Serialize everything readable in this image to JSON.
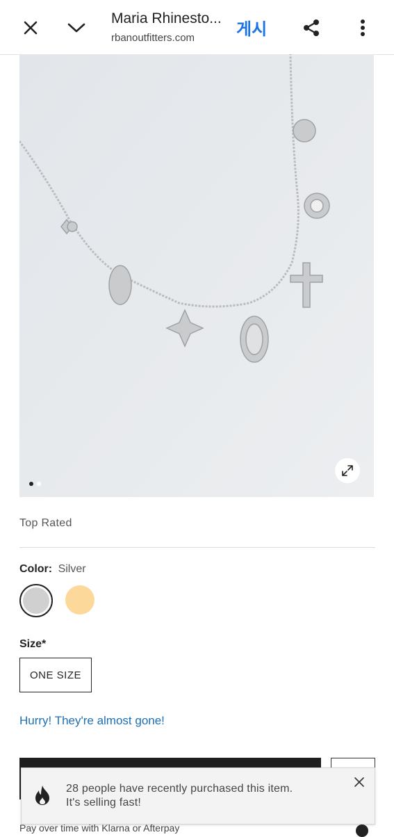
{
  "browser": {
    "title": "Maria Rhinesto...",
    "url": "rbanoutfitters.com",
    "post_label": "게시",
    "icons": [
      "close-icon",
      "chevron-down-icon",
      "share-icon",
      "more-vert-icon"
    ]
  },
  "gallery": {
    "image_desc": "necklace-product-image",
    "dots_count": 2,
    "active_dot": 0
  },
  "product": {
    "top_rated": "Top Rated",
    "color_label": "Color:",
    "color_value": "Silver",
    "swatches": [
      {
        "name": "Silver",
        "color": "#d0d0d0",
        "selected": true
      },
      {
        "name": "Gold",
        "color": "#fcd99a",
        "selected": false
      }
    ],
    "size_label": "Size*",
    "size_option": "ONE SIZE",
    "stock_message": "Hurry! They're almost gone!"
  },
  "payment": {
    "text": "Pay over time with Klarna or Afterpay"
  },
  "toast": {
    "line1": "28 people have recently purchased this item.",
    "line2": "It's selling fast!"
  },
  "colors": {
    "accent": "#1a73e8",
    "link": "#1b6fb5",
    "dark": "#1e1e1e"
  }
}
